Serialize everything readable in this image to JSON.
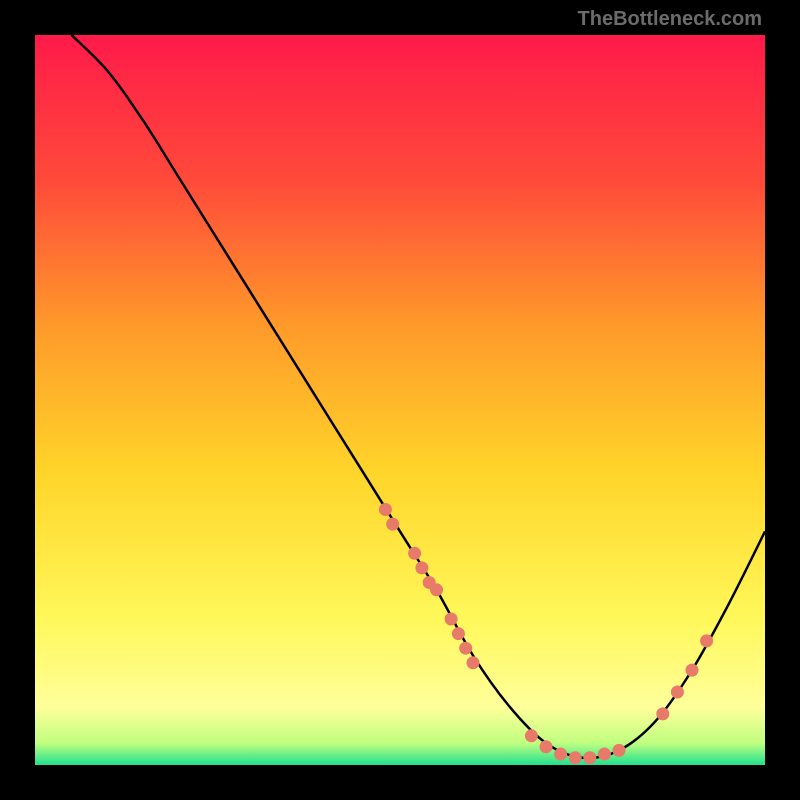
{
  "watermark": "TheBottleneck.com",
  "chart_data": {
    "type": "line",
    "title": "",
    "xlabel": "",
    "ylabel": "",
    "xlim": [
      0,
      100
    ],
    "ylim": [
      0,
      100
    ],
    "gradient_stops": [
      {
        "offset": 0,
        "color": "#ff1a4a"
      },
      {
        "offset": 20,
        "color": "#ff4a3a"
      },
      {
        "offset": 40,
        "color": "#ff9a2a"
      },
      {
        "offset": 60,
        "color": "#ffd52a"
      },
      {
        "offset": 80,
        "color": "#fff85a"
      },
      {
        "offset": 92,
        "color": "#ffff9a"
      },
      {
        "offset": 97,
        "color": "#c0ff80"
      },
      {
        "offset": 100,
        "color": "#20e090"
      }
    ],
    "series": [
      {
        "name": "bottleneck-curve",
        "color": "#000000",
        "points": [
          {
            "x": 5,
            "y": 100
          },
          {
            "x": 10,
            "y": 95
          },
          {
            "x": 15,
            "y": 88
          },
          {
            "x": 20,
            "y": 80
          },
          {
            "x": 30,
            "y": 64
          },
          {
            "x": 40,
            "y": 48
          },
          {
            "x": 50,
            "y": 32
          },
          {
            "x": 55,
            "y": 24
          },
          {
            "x": 60,
            "y": 15
          },
          {
            "x": 65,
            "y": 8
          },
          {
            "x": 70,
            "y": 3
          },
          {
            "x": 75,
            "y": 1
          },
          {
            "x": 80,
            "y": 2
          },
          {
            "x": 85,
            "y": 6
          },
          {
            "x": 90,
            "y": 13
          },
          {
            "x": 95,
            "y": 22
          },
          {
            "x": 100,
            "y": 32
          }
        ]
      }
    ],
    "scatter_points": {
      "name": "sample-points",
      "color": "#e87a6a",
      "points": [
        {
          "x": 48,
          "y": 35
        },
        {
          "x": 49,
          "y": 33
        },
        {
          "x": 52,
          "y": 29
        },
        {
          "x": 53,
          "y": 27
        },
        {
          "x": 54,
          "y": 25
        },
        {
          "x": 55,
          "y": 24
        },
        {
          "x": 57,
          "y": 20
        },
        {
          "x": 58,
          "y": 18
        },
        {
          "x": 59,
          "y": 16
        },
        {
          "x": 60,
          "y": 14
        },
        {
          "x": 68,
          "y": 4
        },
        {
          "x": 70,
          "y": 2.5
        },
        {
          "x": 72,
          "y": 1.5
        },
        {
          "x": 74,
          "y": 1
        },
        {
          "x": 76,
          "y": 1
        },
        {
          "x": 78,
          "y": 1.5
        },
        {
          "x": 80,
          "y": 2
        },
        {
          "x": 86,
          "y": 7
        },
        {
          "x": 88,
          "y": 10
        },
        {
          "x": 90,
          "y": 13
        },
        {
          "x": 92,
          "y": 17
        }
      ]
    }
  }
}
